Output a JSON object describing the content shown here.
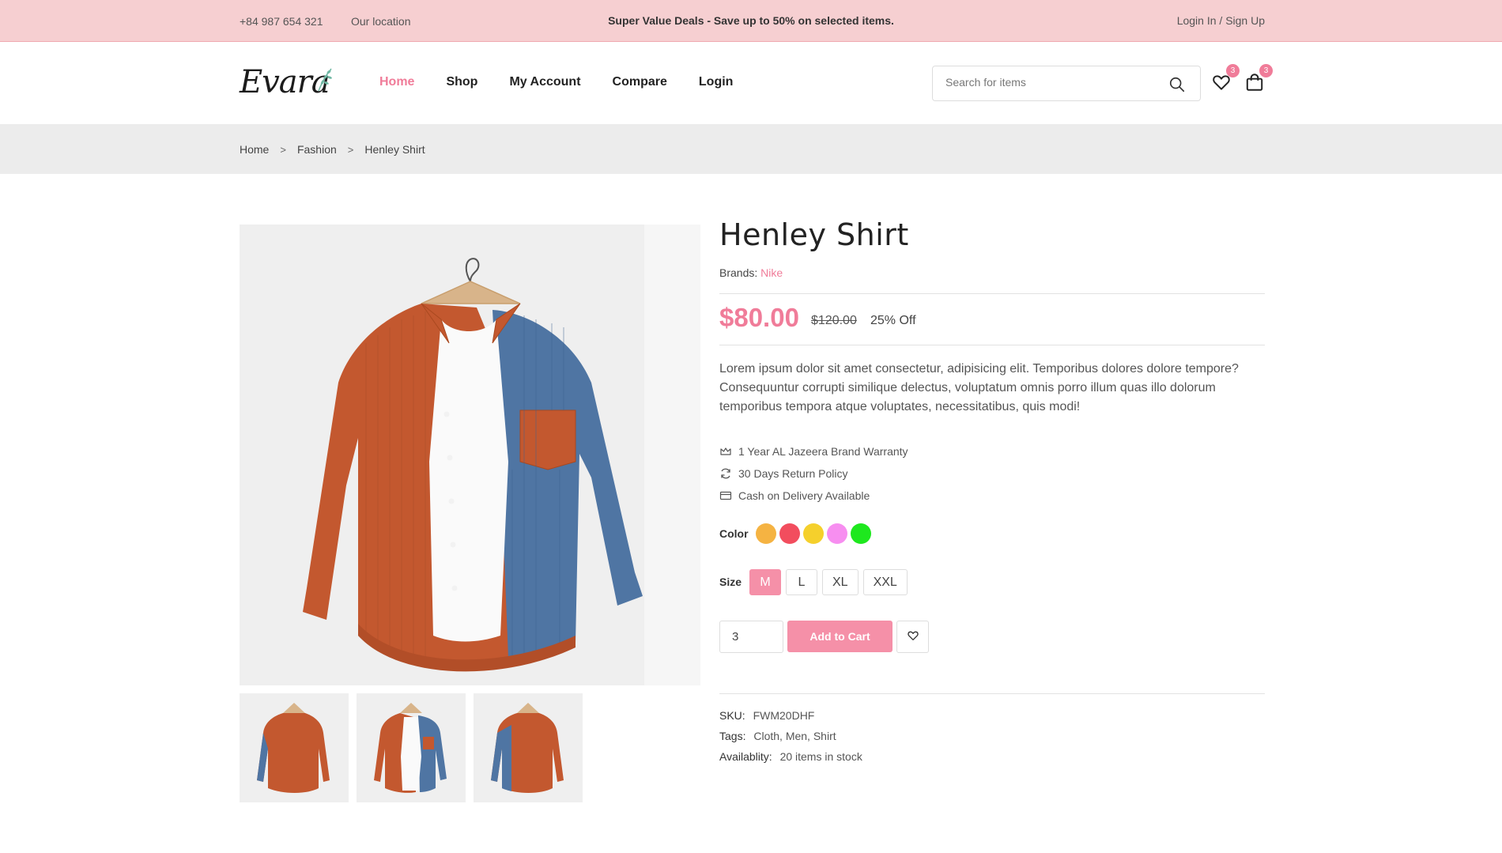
{
  "topbar": {
    "phone": "+84 987 654 321",
    "location": "Our location",
    "deal": "Super Value Deals - Save up to 50% on selected items.",
    "login": "Login In / Sign Up"
  },
  "header": {
    "logo_text": "Evara",
    "nav": [
      {
        "label": "Home",
        "active": true
      },
      {
        "label": "Shop",
        "active": false
      },
      {
        "label": "My Account",
        "active": false
      },
      {
        "label": "Compare",
        "active": false
      },
      {
        "label": "Login",
        "active": false
      }
    ],
    "search_placeholder": "Search for items",
    "wishlist_count": "3",
    "cart_count": "3"
  },
  "breadcrumb": [
    "Home",
    "Fashion",
    "Henley Shirt"
  ],
  "product": {
    "title": "Henley Shirt",
    "brand_label": "Brands:",
    "brand": "Nike",
    "price": "$80.00",
    "old_price": "$120.00",
    "discount": "25% Off",
    "description": "Lorem ipsum dolor sit amet consectetur, adipisicing elit. Temporibus dolores dolore tempore? Consequuntur corrupti similique delectus, voluptatum omnis porro illum quas illo dolorum temporibus tempora atque voluptates, necessitatibus, quis modi!",
    "features": [
      {
        "icon": "crown-icon",
        "text": "1 Year AL Jazeera Brand Warranty"
      },
      {
        "icon": "refresh-icon",
        "text": "30 Days Return Policy"
      },
      {
        "icon": "credit-card-icon",
        "text": "Cash on Delivery Available"
      }
    ],
    "color_label": "Color",
    "colors": [
      "#f5b342",
      "#f24d5e",
      "#f5d02c",
      "#f78ef0",
      "#1ee81e"
    ],
    "size_label": "Size",
    "sizes": [
      "M",
      "L",
      "XL",
      "XXL"
    ],
    "selected_size": "M",
    "quantity": "3",
    "add_to_cart": "Add to Cart",
    "sku_label": "SKU:",
    "sku": "FWM20DHF",
    "tags_label": "Tags:",
    "tags": "Cloth, Men, Shirt",
    "availability_label": "Availablity:",
    "availability": "20 items in stock"
  },
  "colors": {
    "accent": "#f07c99",
    "topbar_bg": "#f6cfd1",
    "shirt_orange": "#c3582f",
    "shirt_blue": "#4f75a3"
  }
}
